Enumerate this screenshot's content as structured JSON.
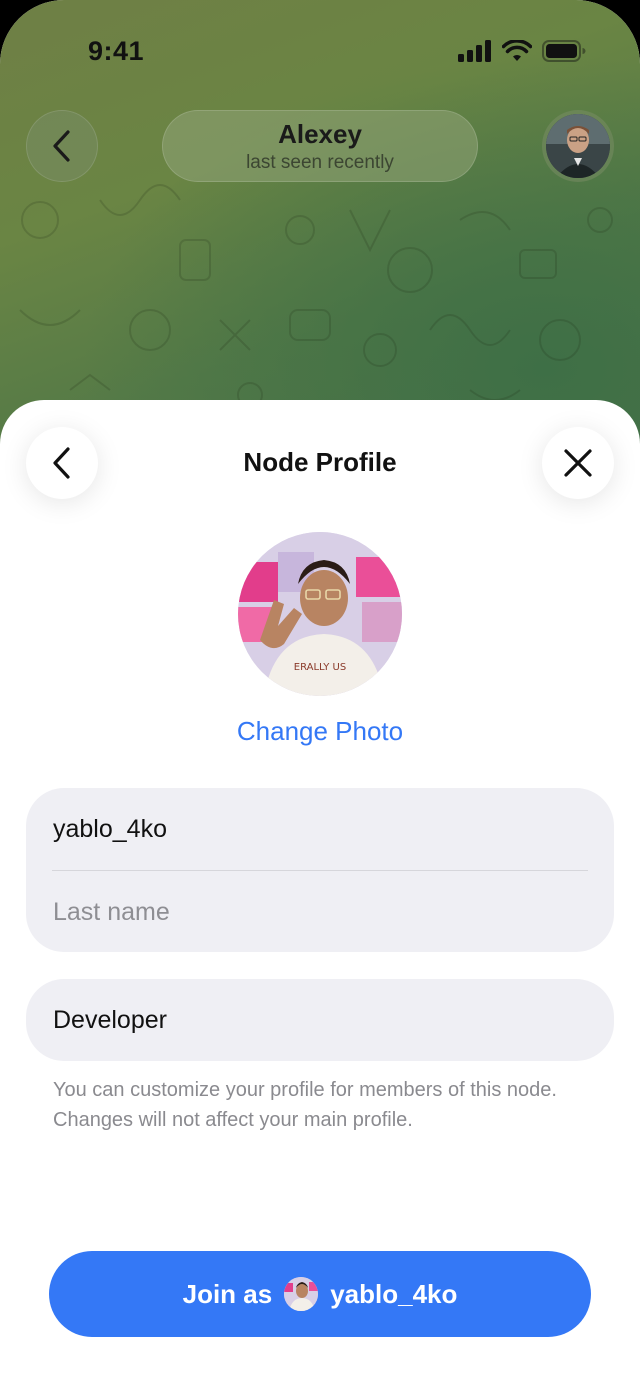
{
  "status_bar": {
    "time": "9:41"
  },
  "chat_header": {
    "contact_name": "Alexey",
    "contact_status": "last seen recently"
  },
  "sheet": {
    "title": "Node Profile",
    "change_photo_label": "Change Photo",
    "first_name_value": "yablo_4ko",
    "last_name_placeholder": "Last name",
    "bio_value": "Developer",
    "hint_text": "You can customize your profile for members of this node. Changes will not affect your main profile.",
    "join_prefix": "Join as",
    "join_name": "yablo_4ko"
  },
  "colors": {
    "accent": "#3478f6",
    "field_bg": "#efeff4",
    "hint": "#8a8a8f"
  },
  "icons": {
    "back": "chevron-left-icon",
    "close": "close-icon",
    "signal": "signal-icon",
    "wifi": "wifi-icon",
    "battery": "battery-icon"
  }
}
